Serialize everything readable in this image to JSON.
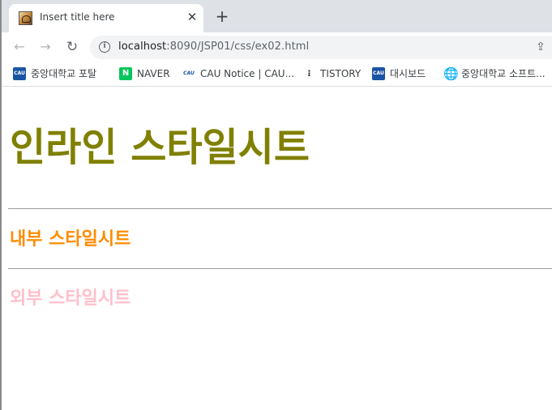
{
  "tab": {
    "title": "Insert title here",
    "close_glyph": "✕",
    "new_tab_glyph": "+"
  },
  "toolbar": {
    "back_glyph": "←",
    "forward_glyph": "→",
    "reload_glyph": "↻",
    "info_glyph": "i",
    "url_host": "localhost",
    "url_path": ":8090/JSP01/css/ex02.html",
    "share_glyph": "⇪"
  },
  "bookmarks": [
    {
      "label": "중앙대학교 포탈",
      "icon": "cau-logo-icon",
      "icon_text": "CAU"
    },
    {
      "label": "NAVER",
      "icon": "naver-logo-icon",
      "icon_text": "N"
    },
    {
      "label": "CAU Notice | CAU...",
      "icon": "cau-notice-icon",
      "icon_text": "CAU"
    },
    {
      "label": "TISTORY",
      "icon": "tistory-logo-icon",
      "icon_text": "⁝"
    },
    {
      "label": "대시보드",
      "icon": "cau-dashboard-icon",
      "icon_text": "CAU"
    },
    {
      "label": "중앙대학교 소프트...",
      "icon": "globe-icon",
      "icon_text": "🌐"
    }
  ],
  "page": {
    "heading_inline": "인라인 스타일시트",
    "heading_internal": "내부 스타일시트",
    "heading_external": "외부 스타일시트"
  },
  "colors": {
    "inline": "#808000",
    "internal": "#ff8c00",
    "external": "#ffc0cb",
    "tabstrip": "#dee1e6"
  }
}
